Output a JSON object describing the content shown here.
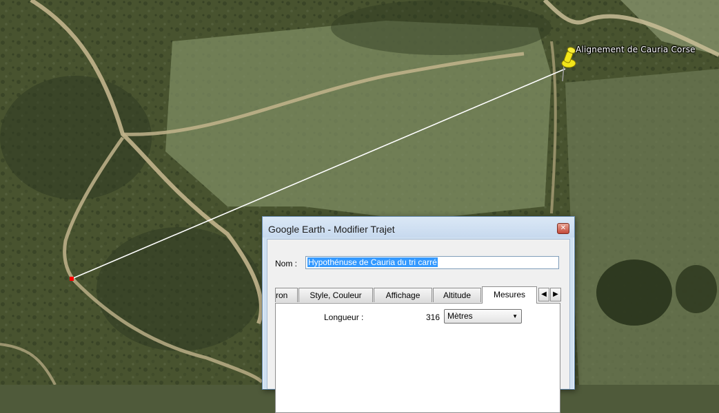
{
  "map": {
    "placemark_label": "Alignement de Cauria Corse",
    "placemark_icon": "yellow-pushpin-icon",
    "path_end_marker": "red-square-marker"
  },
  "dialog": {
    "title": "Google Earth - Modifier Trajet",
    "close_icon": "close-icon",
    "name_label": "Nom :",
    "name_value": "Hypothénuse de Cauria du tri carré",
    "tabs": [
      {
        "label": "ron",
        "active": false
      },
      {
        "label": "Style, Couleur",
        "active": false
      },
      {
        "label": "Affichage",
        "active": false
      },
      {
        "label": "Altitude",
        "active": false
      },
      {
        "label": "Mesures",
        "active": true
      }
    ],
    "tab_scroll_left_icon": "triangle-left-icon",
    "tab_scroll_right_icon": "triangle-right-icon",
    "measures": {
      "length_label": "Longueur :",
      "length_value": "316",
      "unit_selected": "Mètres"
    }
  },
  "colors": {
    "dialog_frame": "#cfe0f1",
    "selection": "#3399ff",
    "path_line": "#ffffff",
    "marker": "#ff0000",
    "pin": "#f2e61a"
  }
}
